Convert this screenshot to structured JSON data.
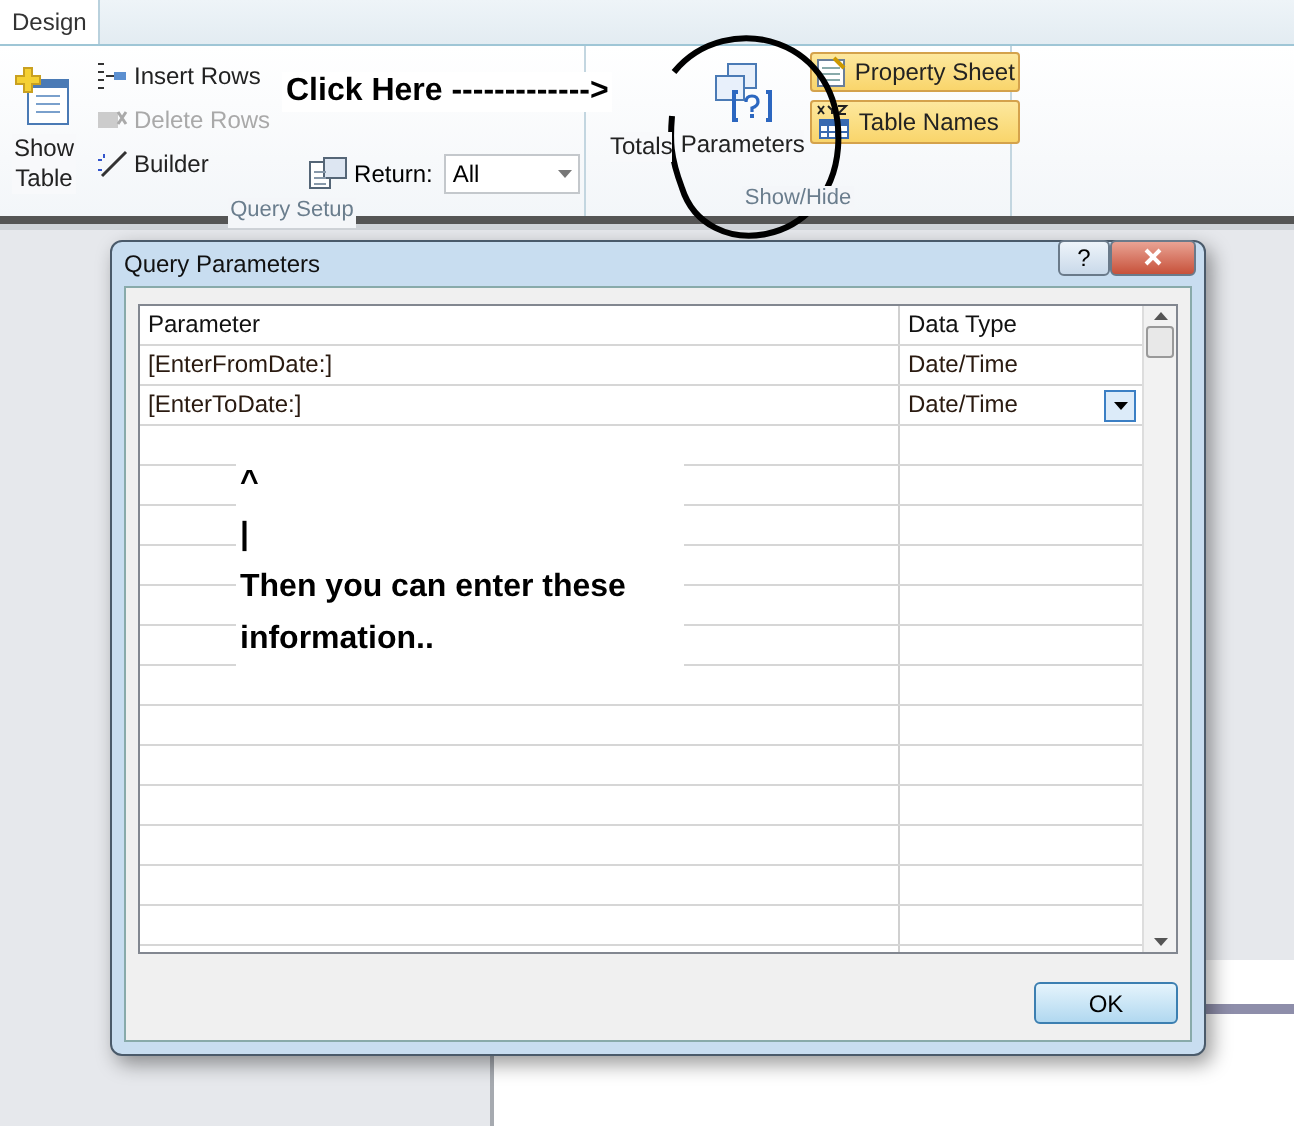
{
  "ribbon": {
    "tabs": [
      {
        "label": "Design",
        "selected": true
      }
    ],
    "groups": [
      {
        "label": "Query Setup",
        "items": [
          {
            "kind": "big",
            "label": "Show Table",
            "highlighted": false,
            "disabled": false
          },
          {
            "kind": "stack",
            "items": [
              {
                "label": "Insert Rows",
                "disabled": false
              },
              {
                "label": "Delete Rows",
                "disabled": true
              },
              {
                "label": "Builder",
                "disabled": false
              }
            ]
          },
          {
            "kind": "combo",
            "label": "Return:",
            "value": "All"
          }
        ]
      },
      {
        "label": "Show/Hide",
        "items": [
          {
            "kind": "big",
            "label": "Totals",
            "highlighted": false,
            "disabled": false
          },
          {
            "kind": "big",
            "label": "Parameters",
            "highlighted": false,
            "disabled": false
          },
          {
            "kind": "toggles",
            "items": [
              {
                "label": "Property Sheet",
                "selected": true
              },
              {
                "label": "Table Names",
                "selected": true
              }
            ]
          }
        ]
      }
    ]
  },
  "callout": {
    "label": "Click Here ------------->"
  },
  "dialog": {
    "title": "Query Parameters",
    "columns": [
      "Parameter",
      "Data Type"
    ],
    "rows": [
      {
        "parameter": "[EnterFromDate:]",
        "data_type": "Date/Time",
        "selected": false
      },
      {
        "parameter": "[EnterToDate:]",
        "data_type": "Date/Time",
        "selected": true
      }
    ],
    "note": {
      "lines": [
        "^",
        "|"
      ],
      "text": "Then you can enter these information.."
    },
    "buttons": [
      "OK"
    ],
    "help": "?"
  }
}
